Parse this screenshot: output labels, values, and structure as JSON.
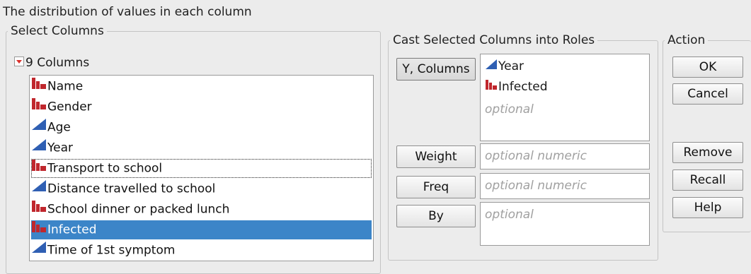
{
  "title": "The distribution of values in each column",
  "select_columns": {
    "legend": "Select Columns",
    "count_label": "9 Columns",
    "items": [
      {
        "label": "Name",
        "type": "nominal"
      },
      {
        "label": "Gender",
        "type": "nominal"
      },
      {
        "label": "Age",
        "type": "continuous"
      },
      {
        "label": "Year",
        "type": "continuous"
      },
      {
        "label": "Transport to school",
        "type": "nominal"
      },
      {
        "label": "Distance travelled to school",
        "type": "continuous"
      },
      {
        "label": "School dinner or packed lunch",
        "type": "nominal"
      },
      {
        "label": "Infected",
        "type": "nominal"
      },
      {
        "label": "Time of 1st symptom",
        "type": "continuous"
      }
    ],
    "selected_item": "Infected",
    "focused_item": "Transport to school"
  },
  "cast_roles": {
    "legend": "Cast Selected Columns into Roles",
    "y_columns": {
      "label": "Y, Columns",
      "items": [
        {
          "label": "Year",
          "type": "continuous"
        },
        {
          "label": "Infected",
          "type": "nominal"
        }
      ],
      "placeholder": "optional"
    },
    "weight": {
      "label": "Weight",
      "placeholder": "optional numeric"
    },
    "freq": {
      "label": "Freq",
      "placeholder": "optional numeric"
    },
    "by": {
      "label": "By",
      "placeholder": "optional"
    }
  },
  "action": {
    "legend": "Action",
    "ok": "OK",
    "cancel": "Cancel",
    "remove": "Remove",
    "recall": "Recall",
    "help": "Help"
  },
  "colors": {
    "nominal_icon": "#c0272d",
    "continuous_icon": "#2f5fb3",
    "selection": "#3c85c8",
    "disclosure": "#d9302c"
  },
  "icons": {
    "nominal": "nominal-bar-icon",
    "continuous": "continuous-triangle-icon",
    "disclosure": "disclosure-triangle-icon"
  }
}
